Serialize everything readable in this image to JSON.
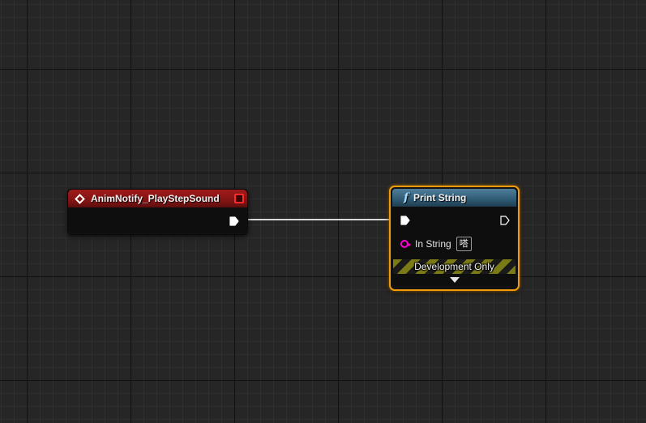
{
  "graph": {
    "event_node": {
      "title": "AnimNotify_PlayStepSound",
      "icon": "event-diamond-icon",
      "header_color": "#8b1515"
    },
    "print_node": {
      "title": "Print String",
      "icon": "function-icon",
      "header_color": "#3a6a88",
      "selected_border_color": "#f29b0c",
      "in_string_label": "In String",
      "in_string_value": "嗒",
      "development_only_label": "Development Only",
      "expand_icon": "chevron-down-icon"
    },
    "wire_color": "#d8d8d8"
  }
}
